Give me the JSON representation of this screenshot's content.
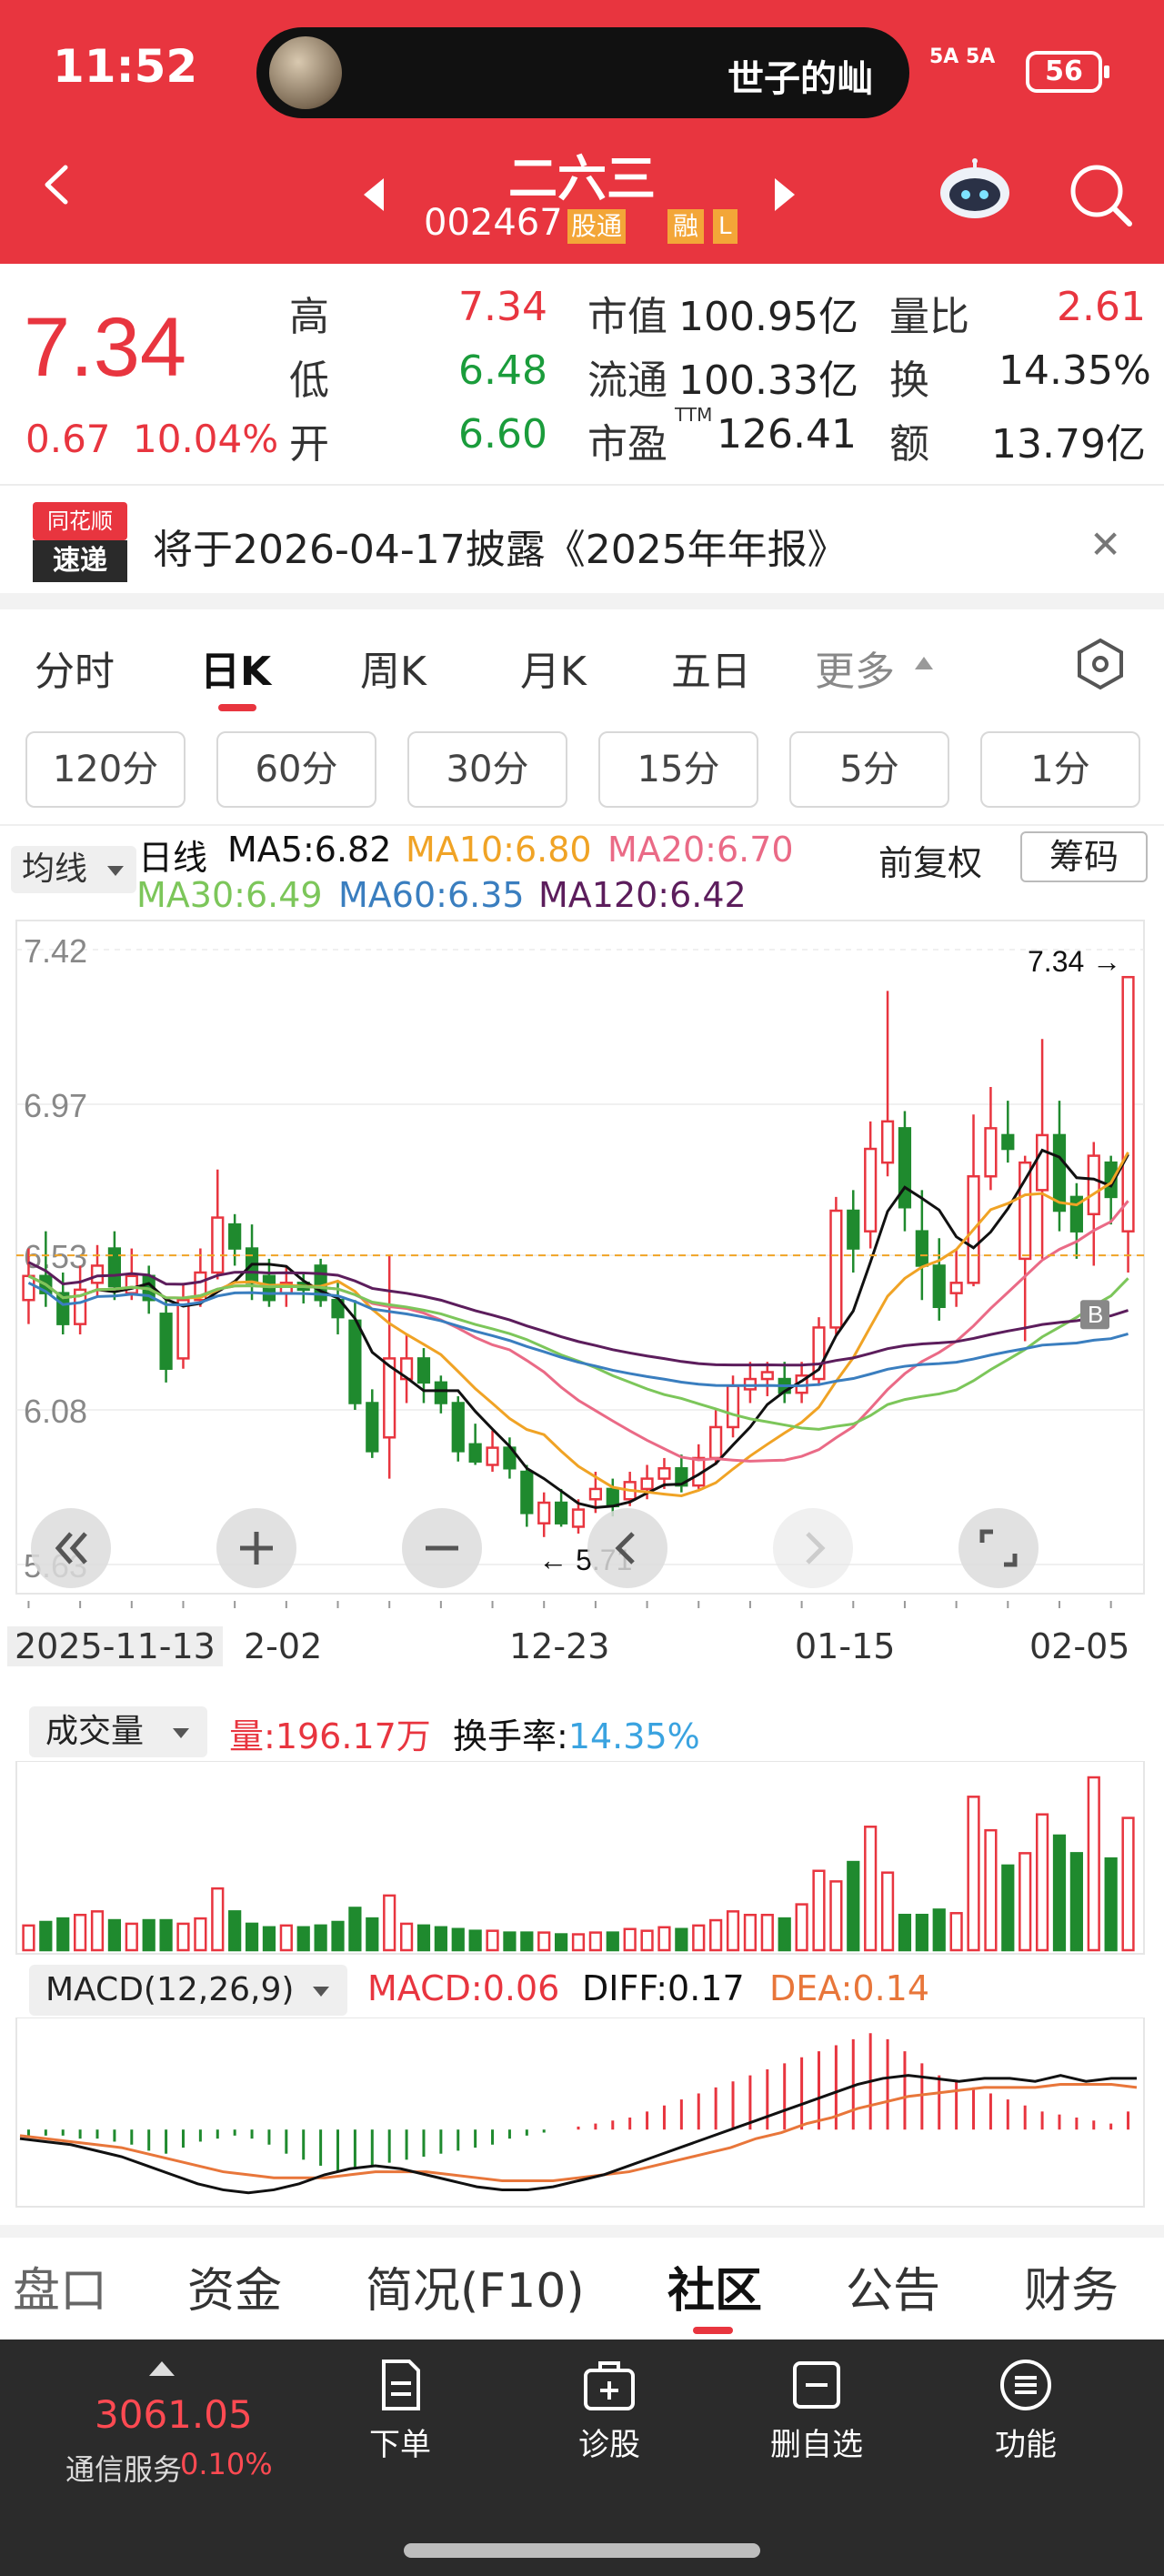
{
  "status_bar": {
    "time": "11:52",
    "notification_text": "世子的屾",
    "signal": "5A 5A",
    "battery": "56"
  },
  "header": {
    "stock_name": "二六三",
    "stock_code": "002467",
    "tag_connect": "股通",
    "tag_margin": "融",
    "tag_l": "L"
  },
  "quote": {
    "price": "7.34",
    "change": "0.67",
    "change_pct": "10.04%",
    "high_label": "高",
    "high": "7.34",
    "low_label": "低",
    "low": "6.48",
    "open_label": "开",
    "open": "6.60",
    "mcap_label": "市值",
    "mcap": "100.95亿",
    "float_label": "流通",
    "float": "100.33亿",
    "pe_label": "市盈",
    "pe_sup": "TTM",
    "pe": "126.41",
    "vr_label": "量比",
    "vr": "2.61",
    "turnover_label": "换",
    "turnover": "14.35%",
    "amount_label": "额",
    "amount": "13.79亿"
  },
  "notice": {
    "logo_top": "同花顺",
    "logo_bottom": "速递",
    "text": "将于2026-04-17披露《2025年年报》"
  },
  "period_tabs": [
    "分时",
    "日K",
    "周K",
    "月K",
    "五日",
    "更多"
  ],
  "minute_tabs": [
    "120分",
    "60分",
    "30分",
    "15分",
    "5分",
    "1分"
  ],
  "legend": {
    "selector": "均线",
    "line_label": "日线",
    "ma5": "MA5:6.82",
    "ma10": "MA10:6.80",
    "ma20": "MA20:6.70",
    "ma30": "MA30:6.49",
    "ma60": "MA60:6.35",
    "ma120": "MA120:6.42",
    "adjust": "前复权",
    "chip_button": "筹码"
  },
  "colors": {
    "up": "#e8353f",
    "down": "#1f8a2e",
    "ma5": "#111111",
    "ma10": "#f0a325",
    "ma20": "#ea6a86",
    "ma30": "#7cc65a",
    "ma60": "#3a7ebf",
    "ma120": "#5c1d5c"
  },
  "kline": {
    "y_ticks": [
      "7.42",
      "6.97",
      "6.53",
      "6.08",
      "5.63"
    ],
    "high_mark": "7.34",
    "low_mark": "5.71",
    "buy_marker": "B",
    "dates": [
      "2025-11-13",
      "2-02",
      "12-23",
      "01-15",
      "02-05"
    ]
  },
  "chart_data": {
    "type": "candlestick",
    "title": "二六三 002467 日K",
    "y_ticks": [
      7.42,
      6.97,
      6.53,
      6.08,
      5.63
    ],
    "ylim": [
      5.63,
      7.42
    ],
    "x_labels": [
      "2025-11-13",
      "2-02",
      "12-23",
      "01-15",
      "02-05"
    ],
    "last_close": 7.34,
    "period_high": 7.34,
    "period_low": 5.71,
    "candles": [
      [
        6.4,
        6.47,
        6.55,
        6.33
      ],
      [
        6.47,
        6.42,
        6.6,
        6.38
      ],
      [
        6.42,
        6.33,
        6.48,
        6.3
      ],
      [
        6.33,
        6.43,
        6.5,
        6.3
      ],
      [
        6.45,
        6.5,
        6.56,
        6.41
      ],
      [
        6.55,
        6.44,
        6.6,
        6.4
      ],
      [
        6.42,
        6.47,
        6.55,
        6.4
      ],
      [
        6.47,
        6.4,
        6.5,
        6.36
      ],
      [
        6.36,
        6.2,
        6.4,
        6.16
      ],
      [
        6.23,
        6.4,
        6.45,
        6.2
      ],
      [
        6.4,
        6.48,
        6.55,
        6.38
      ],
      [
        6.48,
        6.64,
        6.78,
        6.46
      ],
      [
        6.62,
        6.55,
        6.65,
        6.5
      ],
      [
        6.55,
        6.45,
        6.62,
        6.4
      ],
      [
        6.47,
        6.4,
        6.52,
        6.38
      ],
      [
        6.42,
        6.45,
        6.5,
        6.38
      ],
      [
        6.45,
        6.43,
        6.48,
        6.39
      ],
      [
        6.5,
        6.4,
        6.52,
        6.38
      ],
      [
        6.4,
        6.35,
        6.45,
        6.3
      ],
      [
        6.34,
        6.1,
        6.4,
        6.08
      ],
      [
        6.1,
        5.96,
        6.14,
        5.94
      ],
      [
        6.0,
        6.23,
        6.53,
        5.88
      ],
      [
        6.17,
        6.23,
        6.3,
        6.1
      ],
      [
        6.23,
        6.16,
        6.26,
        6.1
      ],
      [
        6.16,
        6.1,
        6.18,
        6.07
      ],
      [
        6.1,
        5.96,
        6.12,
        5.93
      ],
      [
        5.98,
        5.93,
        6.04,
        5.92
      ],
      [
        5.92,
        5.97,
        6.02,
        5.9
      ],
      [
        5.97,
        5.91,
        6.0,
        5.88
      ],
      [
        5.9,
        5.78,
        5.92,
        5.74
      ],
      [
        5.75,
        5.81,
        5.84,
        5.71
      ],
      [
        5.81,
        5.75,
        5.85,
        5.74
      ],
      [
        5.74,
        5.79,
        5.82,
        5.72
      ],
      [
        5.82,
        5.85,
        5.9,
        5.78
      ],
      [
        5.85,
        5.8,
        5.88,
        5.77
      ],
      [
        5.82,
        5.87,
        5.9,
        5.8
      ],
      [
        5.85,
        5.88,
        5.92,
        5.82
      ],
      [
        5.88,
        5.91,
        5.94,
        5.85
      ],
      [
        5.91,
        5.86,
        5.95,
        5.84
      ],
      [
        5.86,
        5.94,
        5.98,
        5.85
      ],
      [
        5.94,
        6.03,
        6.08,
        5.92
      ],
      [
        6.03,
        6.15,
        6.18,
        6.0
      ],
      [
        6.14,
        6.17,
        6.22,
        6.1
      ],
      [
        6.17,
        6.19,
        6.22,
        6.12
      ],
      [
        6.17,
        6.13,
        6.22,
        6.1
      ],
      [
        6.13,
        6.18,
        6.22,
        6.1
      ],
      [
        6.17,
        6.32,
        6.35,
        6.15
      ],
      [
        6.32,
        6.66,
        6.7,
        6.3
      ],
      [
        6.66,
        6.55,
        6.72,
        6.48
      ],
      [
        6.6,
        6.84,
        6.92,
        6.55
      ],
      [
        6.8,
        6.92,
        7.3,
        6.76
      ],
      [
        6.9,
        6.67,
        6.95,
        6.6
      ],
      [
        6.6,
        6.5,
        6.72,
        6.4
      ],
      [
        6.5,
        6.38,
        6.58,
        6.34
      ],
      [
        6.42,
        6.45,
        6.55,
        6.38
      ],
      [
        6.45,
        6.76,
        6.94,
        6.44
      ],
      [
        6.76,
        6.9,
        7.02,
        6.72
      ],
      [
        6.88,
        6.84,
        6.98,
        6.8
      ],
      [
        6.52,
        6.8,
        6.82,
        6.28
      ],
      [
        6.72,
        6.88,
        7.16,
        6.52
      ],
      [
        6.88,
        6.66,
        6.98,
        6.6
      ],
      [
        6.7,
        6.6,
        6.74,
        6.52
      ],
      [
        6.65,
        6.82,
        6.86,
        6.5
      ],
      [
        6.8,
        6.7,
        6.82,
        6.62
      ],
      [
        6.6,
        7.34,
        7.34,
        6.48
      ]
    ],
    "moving_averages": {
      "MA5": 6.82,
      "MA10": 6.8,
      "MA20": 6.7,
      "MA30": 6.49,
      "MA60": 6.35,
      "MA120": 6.42
    },
    "volume": {
      "label": "量",
      "value": "196.17万",
      "turnover_label": "换手率",
      "turnover": "14.35%",
      "series": [
        28,
        32,
        36,
        40,
        44,
        34,
        30,
        34,
        34,
        30,
        36,
        70,
        44,
        30,
        26,
        28,
        26,
        28,
        32,
        48,
        36,
        62,
        30,
        28,
        26,
        24,
        22,
        22,
        20,
        20,
        20,
        18,
        18,
        20,
        20,
        24,
        22,
        26,
        24,
        28,
        34,
        44,
        40,
        40,
        36,
        52,
        90,
        78,
        100,
        140,
        88,
        40,
        40,
        46,
        42,
        174,
        136,
        96,
        110,
        154,
        130,
        110,
        196,
        104,
        150
      ]
    },
    "macd": {
      "params": "MACD(12,26,9)",
      "macd_label": "MACD:0.06",
      "diff_label": "DIFF:0.17",
      "dea_label": "DEA:0.14",
      "hist": [
        -0.02,
        -0.02,
        -0.02,
        -0.03,
        -0.03,
        -0.04,
        -0.05,
        -0.07,
        -0.08,
        -0.06,
        -0.04,
        -0.03,
        -0.02,
        -0.03,
        -0.05,
        -0.08,
        -0.1,
        -0.12,
        -0.14,
        -0.13,
        -0.12,
        -0.11,
        -0.1,
        -0.09,
        -0.08,
        -0.07,
        -0.06,
        -0.05,
        -0.03,
        -0.02,
        -0.01,
        0.0,
        0.01,
        0.02,
        0.03,
        0.04,
        0.06,
        0.08,
        0.1,
        0.12,
        0.14,
        0.16,
        0.18,
        0.2,
        0.22,
        0.24,
        0.26,
        0.28,
        0.3,
        0.32,
        0.3,
        0.26,
        0.22,
        0.18,
        0.16,
        0.14,
        0.12,
        0.1,
        0.08,
        0.06,
        0.05,
        0.04,
        0.03,
        0.02,
        0.06
      ],
      "diff": [
        -0.03,
        -0.04,
        -0.05,
        -0.07,
        -0.09,
        -0.12,
        -0.15,
        -0.18,
        -0.2,
        -0.21,
        -0.2,
        -0.18,
        -0.15,
        -0.13,
        -0.12,
        -0.13,
        -0.15,
        -0.17,
        -0.19,
        -0.2,
        -0.2,
        -0.19,
        -0.17,
        -0.15,
        -0.12,
        -0.09,
        -0.06,
        -0.03,
        0.0,
        0.03,
        0.06,
        0.09,
        0.12,
        0.15,
        0.17,
        0.18,
        0.17,
        0.16,
        0.17,
        0.17,
        0.16,
        0.18,
        0.16,
        0.17,
        0.17
      ],
      "dea": [
        -0.02,
        -0.03,
        -0.04,
        -0.05,
        -0.06,
        -0.08,
        -0.1,
        -0.12,
        -0.14,
        -0.15,
        -0.16,
        -0.16,
        -0.16,
        -0.15,
        -0.14,
        -0.14,
        -0.14,
        -0.15,
        -0.16,
        -0.17,
        -0.17,
        -0.17,
        -0.16,
        -0.15,
        -0.14,
        -0.12,
        -0.1,
        -0.08,
        -0.06,
        -0.03,
        -0.01,
        0.02,
        0.04,
        0.07,
        0.09,
        0.11,
        0.12,
        0.13,
        0.14,
        0.14,
        0.14,
        0.15,
        0.15,
        0.15,
        0.14
      ]
    }
  },
  "bottom_tabs": [
    "盘口",
    "资金",
    "简况(F10)",
    "社区",
    "公告",
    "财务"
  ],
  "nav": {
    "index_value": "3061.05",
    "index_name": "通信服务",
    "index_pct": "0.10%",
    "items": [
      "下单",
      "诊股",
      "删自选",
      "功能"
    ]
  }
}
